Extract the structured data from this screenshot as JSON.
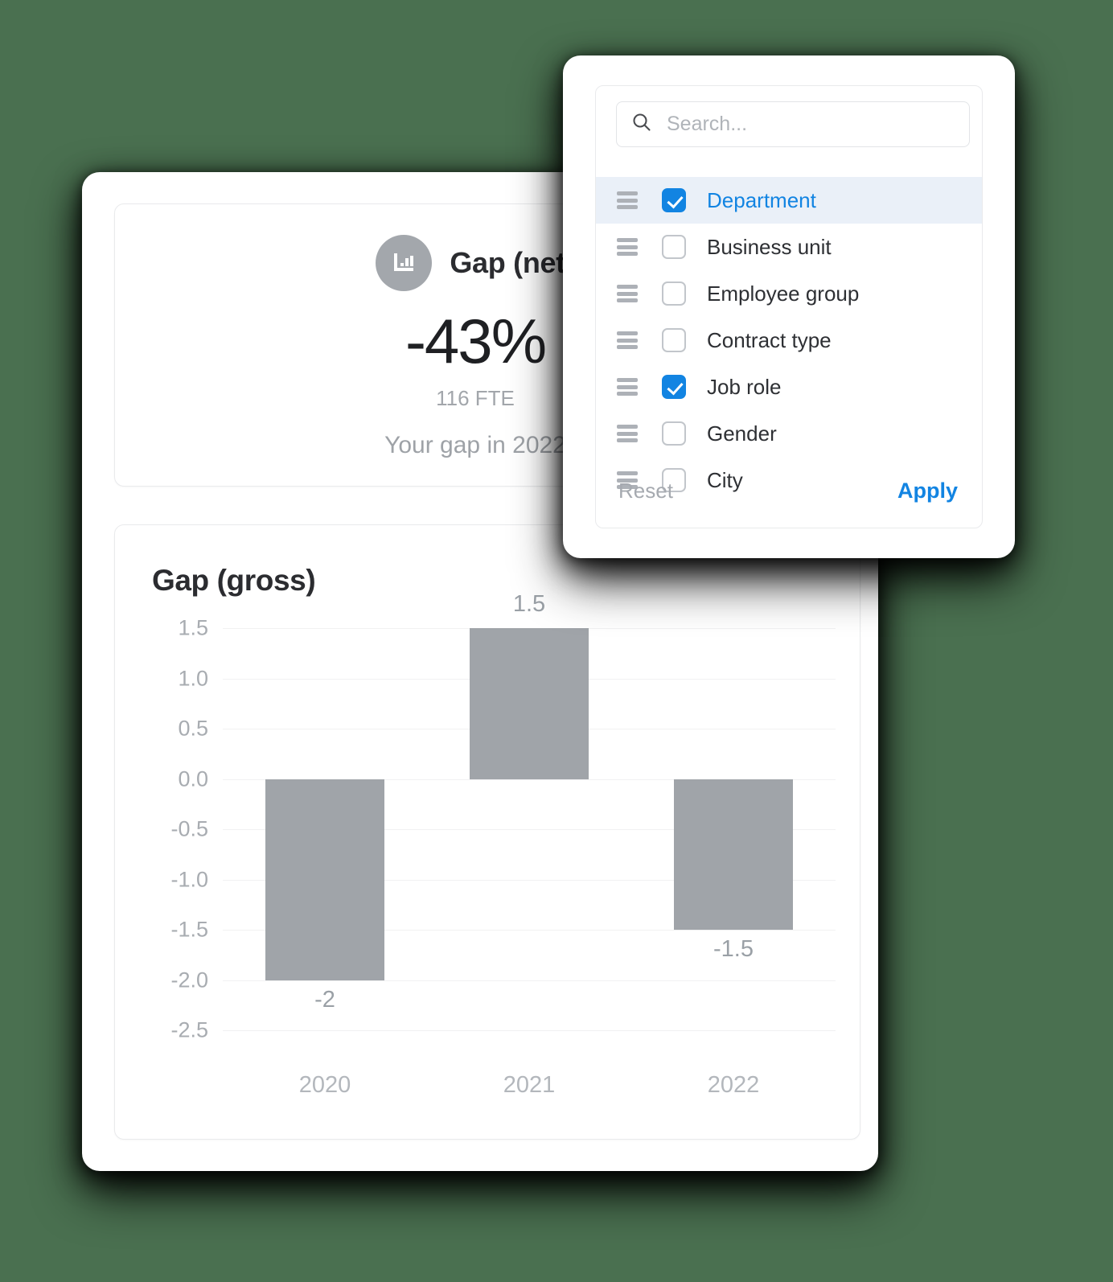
{
  "theme": {
    "background": "#4a7050",
    "accent_blue": "#1284e2",
    "bar_gray": "#a0a4a9",
    "icon_circle_gray": "#a3a7ac",
    "selected_row_bg": "#eaf0f8"
  },
  "dashboard": {
    "gap_net": {
      "icon": "bar-chart-icon",
      "title": "Gap (net)",
      "value": "-43%",
      "subvalue": "116 FTE",
      "caption": "Your gap in 2022"
    },
    "gap_gross": {
      "title": "Gap (gross)"
    }
  },
  "chart_data": {
    "type": "bar",
    "title": "Gap (gross)",
    "categories": [
      "2020",
      "2021",
      "2022"
    ],
    "values": [
      -2,
      1.5,
      -1.5
    ],
    "data_labels": [
      "-2",
      "1.5",
      "-1.5"
    ],
    "xlabel": "",
    "ylabel": "",
    "ylim": [
      -2.5,
      1.5
    ],
    "yticks": [
      1.5,
      1.0,
      0.5,
      0.0,
      -0.5,
      -1.0,
      -1.5,
      -2.0,
      -2.5
    ],
    "ytick_labels": [
      "1.5",
      "1.0",
      "0.5",
      "0.0",
      "-0.5",
      "-1.0",
      "-1.5",
      "-2.0",
      "-2.5"
    ],
    "grid": true,
    "legend": false,
    "series": [
      {
        "name": "Gap (gross)",
        "values": [
          -2,
          1.5,
          -1.5
        ]
      }
    ]
  },
  "filter_panel": {
    "search": {
      "icon": "search-icon",
      "placeholder": "Search...",
      "value": ""
    },
    "items": [
      {
        "label": "Department",
        "checked": true,
        "handle": "drag-handle-icon"
      },
      {
        "label": "Business unit",
        "checked": false,
        "handle": "drag-handle-icon"
      },
      {
        "label": "Employee group",
        "checked": false,
        "handle": "drag-handle-icon"
      },
      {
        "label": "Contract type",
        "checked": false,
        "handle": "drag-handle-icon"
      },
      {
        "label": "Job role",
        "checked": true,
        "handle": "drag-handle-icon"
      },
      {
        "label": "Gender",
        "checked": false,
        "handle": "drag-handle-icon"
      },
      {
        "label": "City",
        "checked": false,
        "handle": "drag-handle-icon"
      }
    ],
    "footer": {
      "reset_label": "Reset",
      "apply_label": "Apply"
    }
  }
}
